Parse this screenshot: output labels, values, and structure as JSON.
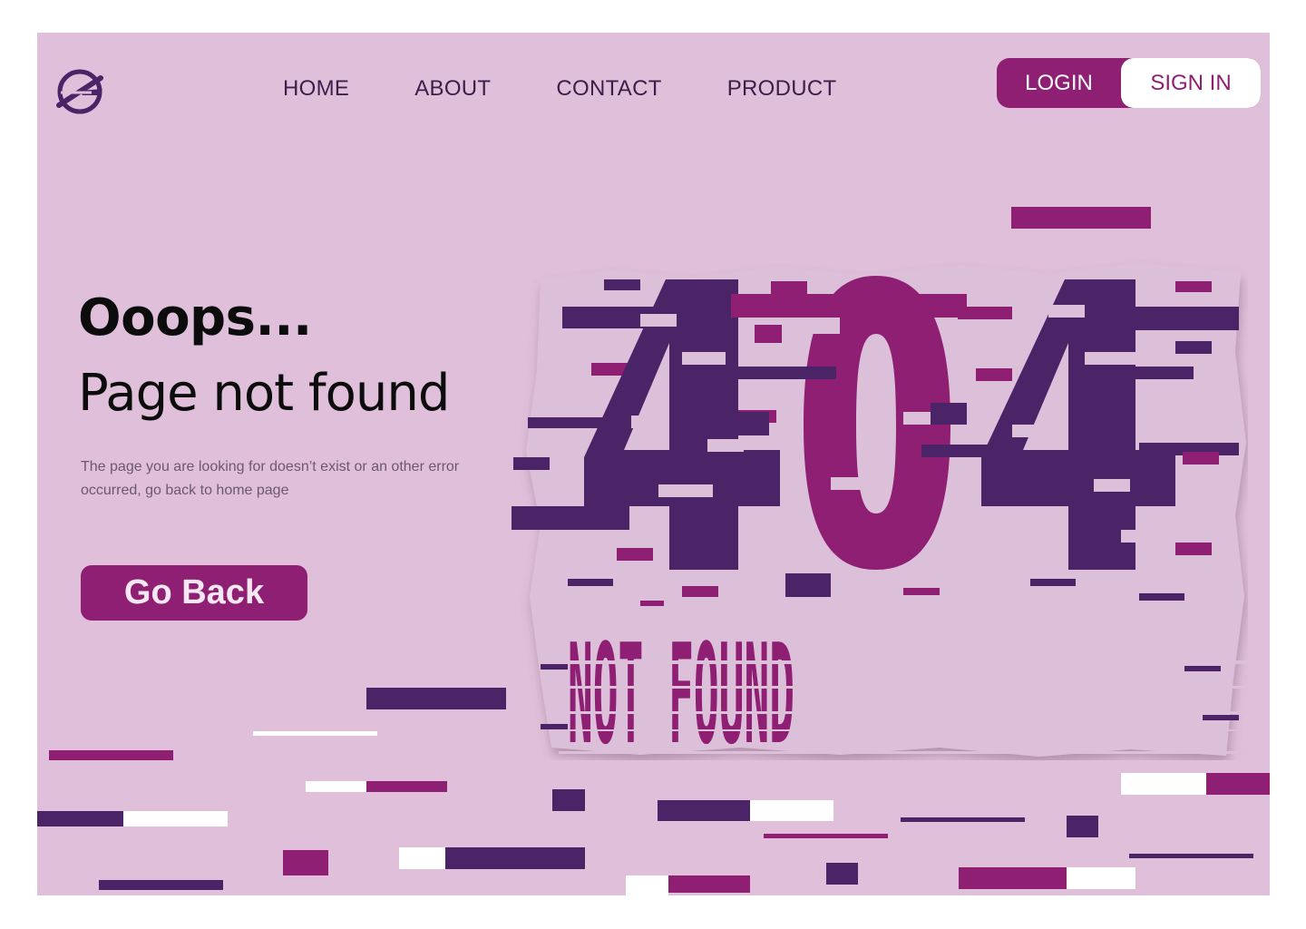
{
  "header": {
    "logo_icon": "globe-plane-logo-icon",
    "nav": [
      "HOME",
      "ABOUT",
      "CONTACT",
      "PRODUCT"
    ],
    "login_label": "LOGIN",
    "signin_label": "SIGN IN"
  },
  "hero": {
    "title": "Ooops...",
    "subtitle": "Page not found",
    "description": "The page you are looking for doesn’t exist or an other error occurred, go back to home page",
    "button_label": "Go Back"
  },
  "illustration": {
    "code": "404",
    "caption": "NOT FOUND"
  },
  "colors": {
    "background": "#dfbfda",
    "purple": "#4b2468",
    "magenta": "#8e1f73",
    "white": "#ffffff"
  }
}
